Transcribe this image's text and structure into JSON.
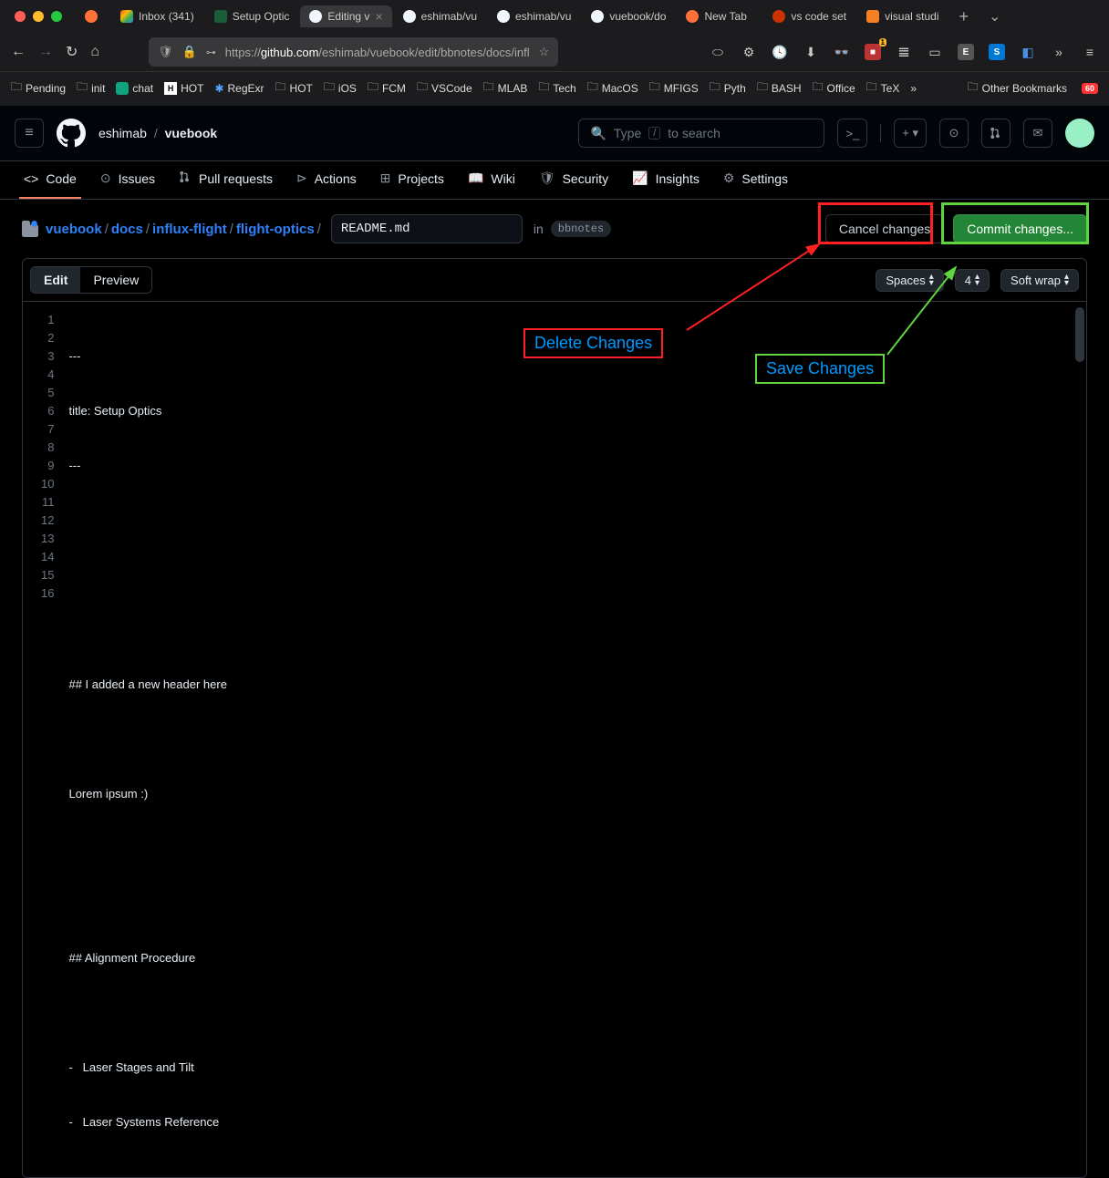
{
  "browser": {
    "tabs": [
      {
        "label": "",
        "icon_color": "#ff7139"
      },
      {
        "label": "Inbox (341)",
        "icon": "M"
      },
      {
        "label": "Setup Optic",
        "icon": "W"
      },
      {
        "label": "Editing v",
        "icon": "gh",
        "active": true
      },
      {
        "label": "eshimab/vu",
        "icon": "gh"
      },
      {
        "label": "eshimab/vu",
        "icon": "gh"
      },
      {
        "label": "vuebook/do",
        "icon": "gh"
      },
      {
        "label": "New Tab",
        "icon_color": "#ff7139"
      },
      {
        "label": "vs code set",
        "icon_color": "#cc3300"
      },
      {
        "label": "visual studi",
        "icon_color": "#f48024"
      }
    ],
    "url_display": "https://github.com/eshimab/vuebook/edit/bbnotes/docs/infl",
    "url_host": "github.com",
    "url_prefix": "https://",
    "url_path": "/eshimab/vuebook/edit/bbnotes/docs/infl",
    "bookmarks": [
      "Pending",
      "init",
      "chat",
      "HOT",
      "RegExr",
      "HOT",
      "iOS",
      "FCM",
      "VSCode",
      "MLAB",
      "Tech",
      "MacOS",
      "MFIGS",
      "Pyth",
      "BASH",
      "Office",
      "TeX"
    ],
    "bookmarks_other": "Other Bookmarks",
    "bookmarks_badge": "60"
  },
  "github": {
    "owner": "eshimab",
    "repo": "vuebook",
    "search_placeholder": "Type",
    "search_hint": "to search",
    "search_key": "/",
    "nav": {
      "code": "Code",
      "issues": "Issues",
      "pull_requests": "Pull requests",
      "actions": "Actions",
      "projects": "Projects",
      "wiki": "Wiki",
      "security": "Security",
      "insights": "Insights",
      "settings": "Settings"
    },
    "path": {
      "root": "vuebook",
      "p1": "docs",
      "p2": "influx-flight",
      "p3": "flight-optics",
      "filename": "README.md",
      "in_label": "in",
      "branch": "bbnotes"
    },
    "buttons": {
      "cancel": "Cancel changes",
      "commit": "Commit changes..."
    },
    "editor_tabs": {
      "edit": "Edit",
      "preview": "Preview"
    },
    "editor_opts": {
      "indent": "Spaces",
      "size": "4",
      "wrap": "Soft wrap"
    },
    "code_lines": [
      "---",
      "title: Setup Optics",
      "---",
      "",
      "",
      "",
      "## I added a new header here",
      "",
      "Lorem ipsum :)",
      "",
      "",
      "## Alignment Procedure",
      "",
      "-   Laser Stages and Tilt",
      "-   Laser Systems Reference"
    ]
  },
  "annotations": {
    "delete": "Delete Changes",
    "save": "Save Changes"
  }
}
